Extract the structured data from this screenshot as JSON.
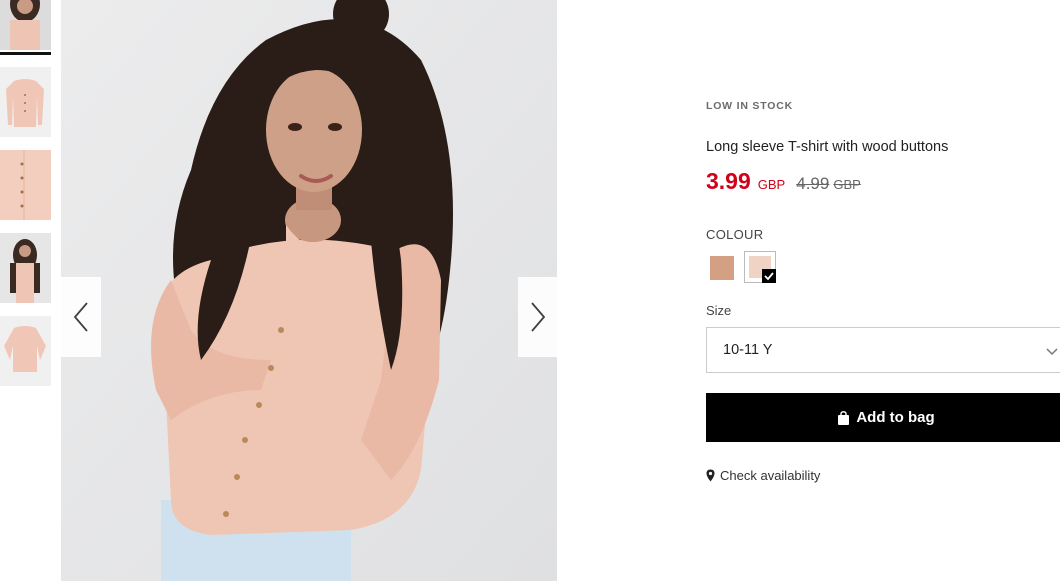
{
  "product": {
    "stock_status": "LOW IN STOCK",
    "title": "Long sleeve T-shirt with wood buttons",
    "price": "3.99",
    "currency": "GBP",
    "old_price": "4.99",
    "old_currency": "GBP",
    "accent_color": "#d0021b"
  },
  "colour": {
    "label": "COLOUR",
    "swatches": [
      {
        "color": "#d4a083",
        "selected": false
      },
      {
        "color": "#f1d3c6",
        "selected": true
      }
    ]
  },
  "size": {
    "label": "Size",
    "selected": "10-11 Y"
  },
  "actions": {
    "add_to_bag": "Add to bag",
    "check_availability": "Check availability"
  },
  "gallery": {
    "thumbnail_count": 5,
    "active_index": 0,
    "prev_icon": "chevron-left-icon",
    "next_icon": "chevron-right-icon"
  }
}
